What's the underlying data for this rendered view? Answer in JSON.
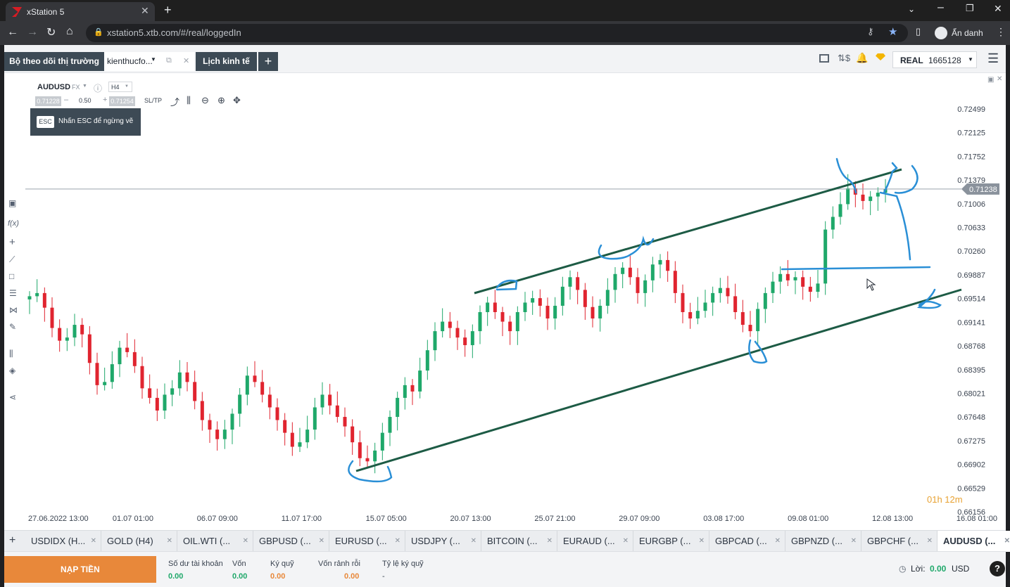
{
  "browser": {
    "tab_title": "xStation 5",
    "url": "xstation5.xtb.com/#/real/loggedIn",
    "profile_label": "Ẩn danh"
  },
  "topbar": {
    "tabs": [
      "Bộ theo dõi thị trường",
      "kienthucfo...",
      "Lịch kinh tế"
    ],
    "account_type": "REAL",
    "account_number": "1665128"
  },
  "chart_panel": {
    "symbol": "AUDUSD",
    "market": "FX",
    "timeframe": "H4",
    "sell_price": "0.71228",
    "volume": "0.50",
    "buy_price": "0.71254",
    "sltp_label": "SL/TP",
    "esc_key": "ESC",
    "esc_hint": "Nhấn ESC để ngừng vẽ",
    "current_price_label": "0.71238",
    "countdown": "01h 12m"
  },
  "chart_data": {
    "type": "candlestick",
    "symbol": "AUDUSD",
    "y_ticks": [
      "0.72499",
      "0.72125",
      "0.71752",
      "0.71379",
      "0.71006",
      "0.70633",
      "0.70260",
      "0.69887",
      "0.69514",
      "0.69141",
      "0.68768",
      "0.68395",
      "0.68021",
      "0.67648",
      "0.67275",
      "0.66902",
      "0.66529",
      "0.66156"
    ],
    "x_ticks": [
      "27.06.2022 13:00",
      "01.07 01:00",
      "06.07 09:00",
      "11.07 17:00",
      "15.07 05:00",
      "20.07 13:00",
      "25.07 21:00",
      "29.07 09:00",
      "03.08 17:00",
      "09.08 01:00",
      "12.08 13:00",
      "16.08 01:00"
    ],
    "ylim": [
      0.66156,
      0.72499
    ],
    "current_price": 0.71238,
    "colors": {
      "up": "#1fa86a",
      "down": "#e0242f",
      "trendline": "#1d5b45",
      "drawing": "#2a8fd6"
    },
    "close_path": [
      0.6955,
      0.696,
      0.6937,
      0.6905,
      0.6885,
      0.689,
      0.691,
      0.6895,
      0.685,
      0.6815,
      0.682,
      0.6848,
      0.6874,
      0.6867,
      0.6845,
      0.681,
      0.6795,
      0.6775,
      0.68,
      0.681,
      0.6835,
      0.682,
      0.679,
      0.676,
      0.6745,
      0.673,
      0.6745,
      0.677,
      0.68,
      0.683,
      0.682,
      0.68,
      0.678,
      0.676,
      0.674,
      0.6718,
      0.6725,
      0.6745,
      0.678,
      0.68,
      0.6783,
      0.6765,
      0.675,
      0.6725,
      0.67,
      0.6695,
      0.6712,
      0.674,
      0.6765,
      0.6795,
      0.6815,
      0.6805,
      0.6838,
      0.687,
      0.69,
      0.6915,
      0.6905,
      0.689,
      0.6878,
      0.69,
      0.693,
      0.6945,
      0.693,
      0.6915,
      0.69,
      0.693,
      0.6945,
      0.6952,
      0.694,
      0.692,
      0.694,
      0.697,
      0.6985,
      0.6965,
      0.6938,
      0.692,
      0.694,
      0.6965,
      0.699,
      0.7,
      0.6985,
      0.696,
      0.698,
      0.7005,
      0.7012,
      0.6995,
      0.696,
      0.693,
      0.692,
      0.6932,
      0.6945,
      0.696,
      0.6968,
      0.6955,
      0.693,
      0.691,
      0.69,
      0.6935,
      0.696,
      0.6978,
      0.699,
      0.698,
      0.6985,
      0.697,
      0.6962,
      0.6975,
      0.706,
      0.708,
      0.71,
      0.7125,
      0.7115,
      0.7105,
      0.7112,
      0.7118,
      0.7124
    ]
  },
  "instrument_tabs": [
    "USDIDX (H...",
    "GOLD (H4)",
    "OIL.WTI (...",
    "GBPUSD (...",
    "EURUSD (...",
    "USDJPY (...",
    "BITCOIN (...",
    "EURAUD (...",
    "EURGBP (...",
    "GBPCAD (...",
    "GBPNZD (...",
    "GBPCHF (...",
    "AUDUSD (..."
  ],
  "bottom": {
    "deposit_button": "NẠP TIỀN",
    "balance_label": "Số dư tài khoản",
    "balance_value": "0.00",
    "equity_label": "Vốn",
    "equity_value": "0.00",
    "margin_label": "Ký quỹ",
    "margin_value": "0.00",
    "free_margin_label": "Vốn rảnh rỗi",
    "free_margin_value": "0.00",
    "margin_level_label": "Tỷ lệ ký quỹ",
    "margin_level_value": "-",
    "profit_label": "Lời:",
    "profit_value": "0.00",
    "profit_currency": "USD"
  }
}
